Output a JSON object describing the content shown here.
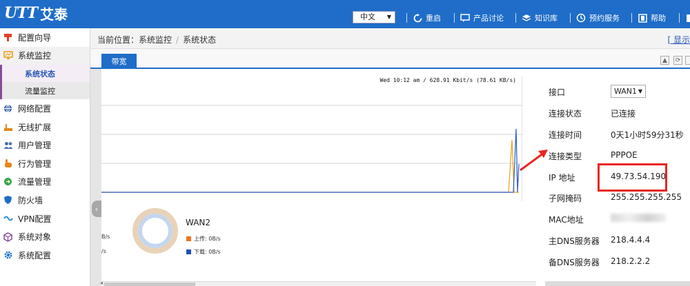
{
  "brand": {
    "mark": "UTT",
    "name": "艾泰"
  },
  "header": {
    "language": "中文",
    "nav": [
      {
        "label": "重启",
        "icon": "restart-icon"
      },
      {
        "label": "产品讨论",
        "icon": "discussion-icon"
      },
      {
        "label": "知识库",
        "icon": "knowledge-base-icon"
      },
      {
        "label": "预约服务",
        "icon": "appointment-icon"
      },
      {
        "label": "帮助",
        "icon": "help-icon"
      }
    ]
  },
  "sidebar": {
    "items": [
      {
        "label": "配置向导",
        "icon": "wizard-icon",
        "color": "#e0402a"
      },
      {
        "label": "系统监控",
        "icon": "monitor-icon",
        "color": "#e6a21c"
      },
      {
        "label": "网络配置",
        "icon": "network-icon",
        "color": "#2b5aa8"
      },
      {
        "label": "无线扩展",
        "icon": "wireless-icon",
        "color": "#e08a1a"
      },
      {
        "label": "用户管理",
        "icon": "users-icon",
        "color": "#4a6fa8"
      },
      {
        "label": "行为管理",
        "icon": "behavior-icon",
        "color": "#e8851a"
      },
      {
        "label": "流量管理",
        "icon": "traffic-icon",
        "color": "#3aa34a"
      },
      {
        "label": "防火墙",
        "icon": "firewall-icon",
        "color": "#1f6dc8"
      },
      {
        "label": "VPN配置",
        "icon": "vpn-icon",
        "color": "#2a8fd8"
      },
      {
        "label": "系统对象",
        "icon": "objects-icon",
        "color": "#8a4a9a"
      },
      {
        "label": "系统配置",
        "icon": "system-config-icon",
        "color": "#2a7ac8"
      }
    ],
    "subitems": [
      {
        "label": "系统状态",
        "active": true
      },
      {
        "label": "流量监控",
        "active": false
      }
    ]
  },
  "breadcrumb": {
    "prefix": "当前位置：",
    "parts": [
      "系统监控",
      "系统状态"
    ],
    "back_link": "[ 显示"
  },
  "tabs": [
    {
      "label": "带宽"
    }
  ],
  "graph": {
    "caption": "Wed 10:12 am / 628.91 Kbit/s (78.61 KB/s)",
    "upload_color": "#e8a21c",
    "download_color": "#2b5ac8"
  },
  "wan": {
    "name": "WAN2",
    "rate_label_1": "B/s",
    "rate_label_2": "/s",
    "upload": {
      "label": "上传: 0B/s",
      "color": "#e8751a"
    },
    "download": {
      "label": "下载: 0B/s",
      "color": "#1f4fb8"
    }
  },
  "info": {
    "interface": {
      "key": "接口",
      "value": "WAN1"
    },
    "rows": [
      {
        "key": "连接状态",
        "value": "已连接"
      },
      {
        "key": "连接时间",
        "value": "0天1小时59分31秒"
      },
      {
        "key": "连接类型",
        "value": "PPPOE"
      },
      {
        "key": "IP 地址",
        "value": "49.73.54.190"
      },
      {
        "key": "子网掩码",
        "value": "255.255.255.255"
      },
      {
        "key": "MAC地址",
        "value": ""
      },
      {
        "key": "主DNS服务器",
        "value": "218.4.4.4"
      },
      {
        "key": "备DNS服务器",
        "value": "218.2.2.2"
      }
    ]
  },
  "colors": {
    "accent": "#1f6dc8",
    "highlight": "#e8261f"
  }
}
